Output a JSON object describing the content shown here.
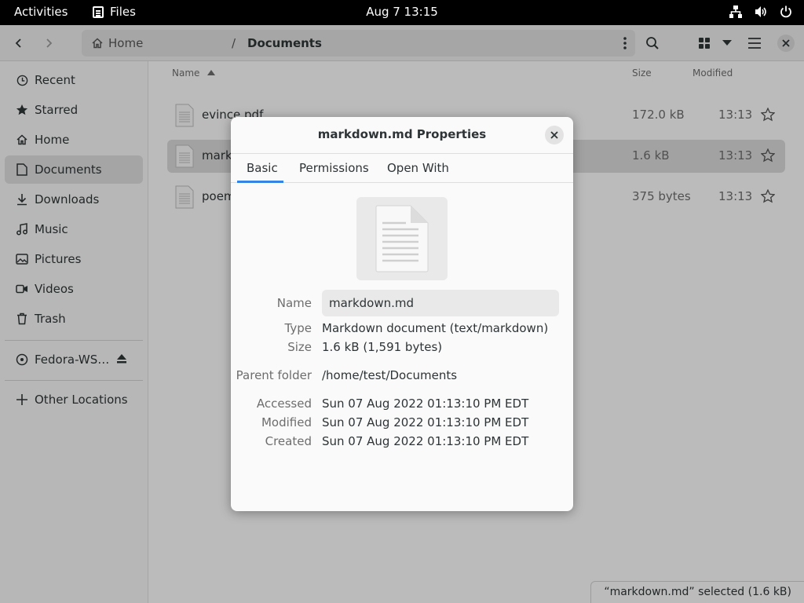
{
  "topbar": {
    "activities": "Activities",
    "app_name": "Files",
    "clock": "Aug 7  13:15",
    "tray_icons": [
      "network-icon",
      "volume-icon",
      "power-icon"
    ]
  },
  "headerbar": {
    "path": {
      "home": "Home",
      "separator": "/",
      "current": "Documents"
    }
  },
  "sidebar": {
    "items": [
      {
        "label": "Recent",
        "icon": "clock-icon"
      },
      {
        "label": "Starred",
        "icon": "star-icon"
      },
      {
        "label": "Home",
        "icon": "home-icon"
      },
      {
        "label": "Documents",
        "icon": "document-icon",
        "active": true
      },
      {
        "label": "Downloads",
        "icon": "download-icon"
      },
      {
        "label": "Music",
        "icon": "music-icon"
      },
      {
        "label": "Pictures",
        "icon": "picture-icon"
      },
      {
        "label": "Videos",
        "icon": "video-icon"
      },
      {
        "label": "Trash",
        "icon": "trash-icon"
      }
    ],
    "device": {
      "label": "Fedora-WS…",
      "icon": "disk-icon"
    },
    "other": {
      "label": "Other Locations",
      "icon": "plus-icon"
    }
  },
  "list": {
    "columns": {
      "name": "Name",
      "size": "Size",
      "modified": "Modified"
    },
    "rows": [
      {
        "name": "evince.pdf",
        "size": "172.0 kB",
        "modified": "13:13"
      },
      {
        "name": "markdown.md",
        "size": "1.6 kB",
        "modified": "13:13",
        "selected": true
      },
      {
        "name": "poem.txt",
        "size": "375 bytes",
        "modified": "13:13"
      }
    ]
  },
  "status": "“markdown.md” selected  (1.6 kB)",
  "dialog": {
    "title": "markdown.md Properties",
    "tabs": [
      "Basic",
      "Permissions",
      "Open With"
    ],
    "active_tab": "Basic",
    "fields": {
      "name_label": "Name",
      "name_value": "markdown.md",
      "type_label": "Type",
      "type_value": "Markdown document (text/markdown)",
      "size_label": "Size",
      "size_value": "1.6 kB (1,591 bytes)",
      "parent_label": "Parent folder",
      "parent_value": "/home/test/Documents",
      "accessed_label": "Accessed",
      "accessed_value": "Sun 07 Aug 2022 01:13:10 PM EDT",
      "modified_label": "Modified",
      "modified_value": "Sun 07 Aug 2022 01:13:10 PM EDT",
      "created_label": "Created",
      "created_value": "Sun 07 Aug 2022 01:13:10 PM EDT"
    }
  },
  "colors": {
    "accent": "#3584e4",
    "topbar": "#000000"
  }
}
